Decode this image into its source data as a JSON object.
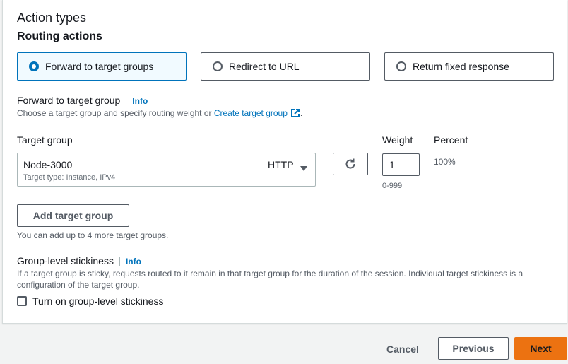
{
  "section": {
    "title": "Action types",
    "subtitle": "Routing actions"
  },
  "routing_actions": [
    {
      "label": "Forward to target groups",
      "selected": true
    },
    {
      "label": "Redirect to URL",
      "selected": false
    },
    {
      "label": "Return fixed response",
      "selected": false
    }
  ],
  "forward": {
    "label": "Forward to target group",
    "info": "Info",
    "description_prefix": "Choose a target group and specify routing weight or ",
    "description_link": "Create target group",
    "description_suffix": "."
  },
  "columns": {
    "target_group": "Target group",
    "weight": "Weight",
    "percent": "Percent"
  },
  "target_group": {
    "value": "Node-3000",
    "sub": "Target type: Instance, IPv4",
    "protocol": "HTTP",
    "weight": "1",
    "weight_hint": "0-999",
    "percent": "100%"
  },
  "add_target": {
    "button_label": "Add target group",
    "hint": "You can add up to 4 more target groups."
  },
  "stickiness": {
    "label": "Group-level stickiness",
    "info": "Info",
    "description": "If a target group is sticky, requests routed to it remain in that target group for the duration of the session. Individual target stickiness is a configuration of the target group.",
    "checkbox_label": "Turn on group-level stickiness",
    "checked": false
  },
  "footer": {
    "cancel": "Cancel",
    "previous": "Previous",
    "next": "Next"
  },
  "colors": {
    "accent": "#0073bb",
    "primary_button": "#ec7211",
    "selected_tile_bg": "#f1faff"
  },
  "icons": [
    "external-link-icon",
    "refresh-icon",
    "caret-down-icon"
  ]
}
